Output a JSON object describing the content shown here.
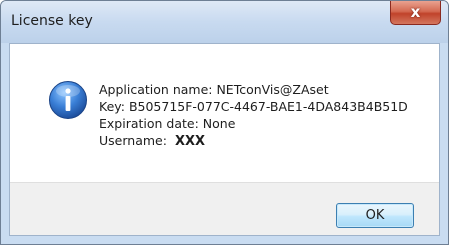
{
  "dialog": {
    "title": "License key",
    "close_label": "x",
    "ok_label": "OK"
  },
  "info": {
    "application_line": "Application name: NETconVis@ZAset",
    "key_line": "Key: B505715F-077C-4467-BAE1-4DA843B4B51D",
    "expiration_line": "Expiration date: None",
    "username_label": "Username:",
    "username_value": "XXX"
  },
  "colors": {
    "title_bar": "#c8daf0",
    "close_button": "#c0432b",
    "ok_button_border": "#3c7fb1",
    "footer_background": "#f0f0f0",
    "info_icon": "#2a63b8"
  },
  "icons": {
    "close": "close-icon",
    "info": "information-icon"
  }
}
